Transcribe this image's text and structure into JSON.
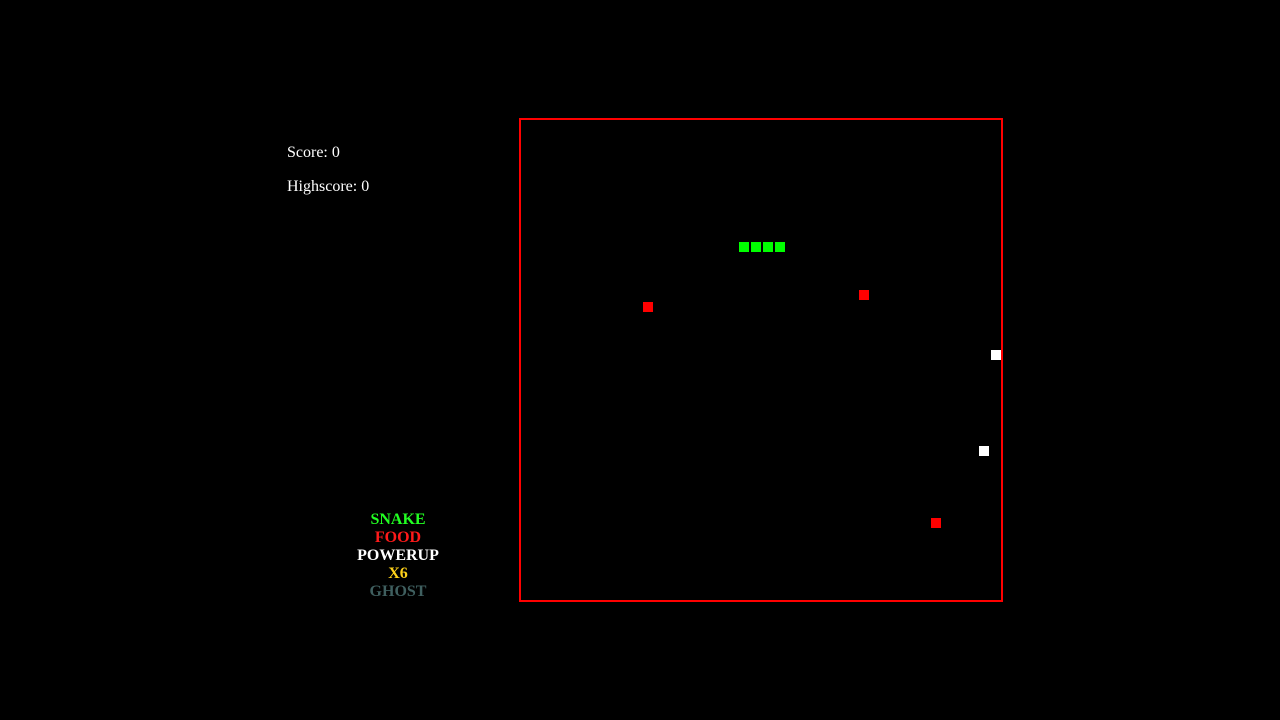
{
  "hud": {
    "score_label": "Score: 0",
    "highscore_label": "Highscore: 0"
  },
  "legend": [
    {
      "label": "SNAKE",
      "color": "#22ff22"
    },
    {
      "label": "FOOD",
      "color": "#ff1a1a"
    },
    {
      "label": "POWERUP",
      "color": "#ffffff"
    },
    {
      "label": "X6",
      "color": "#ffd21a"
    },
    {
      "label": "GHOST",
      "color": "#3f5f5f"
    }
  ],
  "board": {
    "border_color": "#ff0000",
    "cell_size_units": 1,
    "snake": {
      "color": "#00ff00",
      "segments": [
        {
          "col": 18,
          "row": 10
        },
        {
          "col": 19,
          "row": 10
        },
        {
          "col": 20,
          "row": 10
        },
        {
          "col": 21,
          "row": 10
        }
      ]
    },
    "food": {
      "color": "#ff0000",
      "items": [
        {
          "col": 10,
          "row": 15
        },
        {
          "col": 28,
          "row": 14
        },
        {
          "col": 34,
          "row": 33
        }
      ]
    },
    "powerups": {
      "color": "#ffffff",
      "items": [
        {
          "col": 39,
          "row": 19
        },
        {
          "col": 38,
          "row": 27
        }
      ]
    }
  }
}
